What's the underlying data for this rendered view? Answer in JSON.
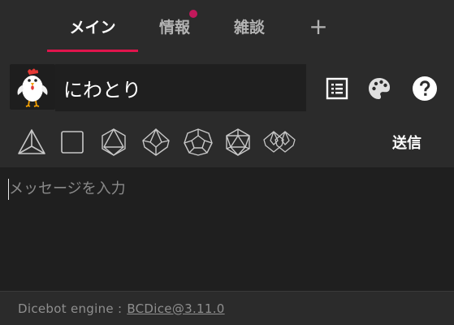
{
  "tabs": [
    {
      "label": "メイン"
    },
    {
      "label": "情報"
    },
    {
      "label": "雑談"
    },
    {
      "label": "+"
    }
  ],
  "character": {
    "name": "にわとり",
    "avatar": "chicken-avatar"
  },
  "toolbar_icons": [
    "list-icon",
    "palette-icon",
    "help-icon"
  ],
  "dice": [
    "d4-icon",
    "d6-icon",
    "d8-icon",
    "d10-icon",
    "d12-icon",
    "d20-icon",
    "d100-icon"
  ],
  "send_label": "送信",
  "message": {
    "placeholder": "メッセージを入力",
    "value": ""
  },
  "footer": {
    "label": "Dicebot engine :",
    "link": "BCDice@3.11.0"
  },
  "colors": {
    "accent": "#e0144c",
    "background": "#2b2b2b",
    "input_background": "#1f1f1f"
  }
}
